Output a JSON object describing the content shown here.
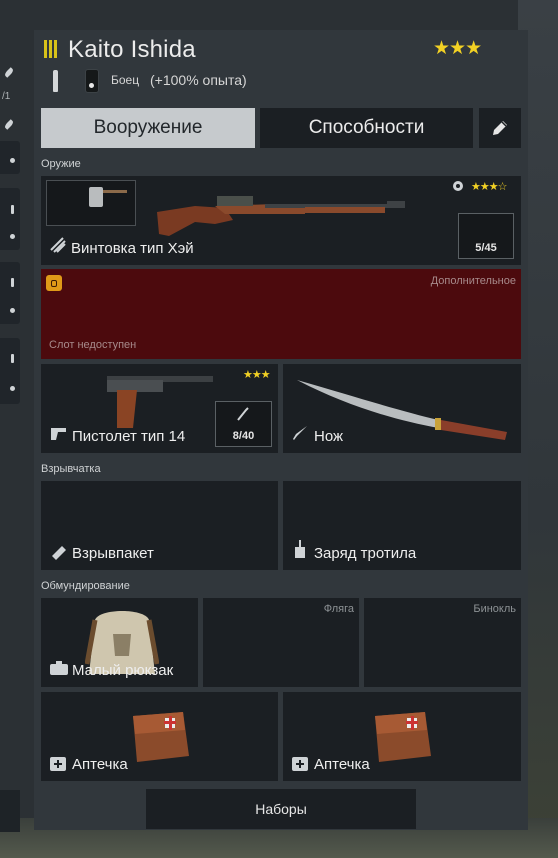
{
  "sidebar": {
    "fraction_text": "/1"
  },
  "soldier": {
    "name": "Kaito Ishida",
    "stars": "★★★",
    "role": "Боец",
    "xp_bonus": "(+100% опыта)"
  },
  "tabs": {
    "weapons": "Вооружение",
    "abilities": "Способности"
  },
  "sections": {
    "weapons": "Оружие",
    "explosives": "Взрывчатка",
    "equipment": "Обмундирование"
  },
  "slots": {
    "primary": {
      "name": "Винтовка тип Хэй",
      "ammo": "5/45",
      "stars": "★★★☆"
    },
    "secondary_locked": {
      "corner": "Дополнительное",
      "status": "Слот недоступен"
    },
    "pistol": {
      "name": "Пистолет тип 14",
      "ammo": "8/40",
      "stars": "★★★"
    },
    "melee": {
      "name": "Нож"
    },
    "explosive_1": {
      "name": "Взрывпакет"
    },
    "explosive_2": {
      "name": "Заряд тротила"
    },
    "backpack": {
      "name": "Малый рюкзак"
    },
    "flask": {
      "corner": "Фляга"
    },
    "binoculars": {
      "corner": "Бинокль"
    },
    "medkit_1": {
      "name": "Аптечка"
    },
    "medkit_2": {
      "name": "Аптечка"
    }
  },
  "presets_button": "Наборы",
  "colors": {
    "accent_star": "#f2d124",
    "rank": "#d8c21a",
    "locked_slot": "#4c0a0d",
    "lock_icon": "#e09a18",
    "tab_active": "#c6cacd"
  }
}
